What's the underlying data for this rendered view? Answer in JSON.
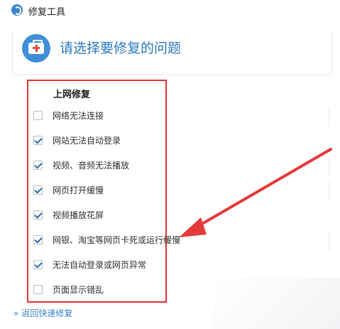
{
  "window": {
    "title": "修复工具"
  },
  "header": {
    "title": "请选择要修复的问题"
  },
  "section": {
    "title": "上网修复",
    "options": [
      {
        "label": "网络无法连接",
        "checked": false
      },
      {
        "label": "网站无法自动登录",
        "checked": true
      },
      {
        "label": "视频、音频无法播放",
        "checked": true
      },
      {
        "label": "网页打开缓慢",
        "checked": true
      },
      {
        "label": "视频播放花屏",
        "checked": true
      },
      {
        "label": "网银、淘宝等网页卡死或运行缓慢",
        "checked": true
      },
      {
        "label": "无法自动登录或网页异常",
        "checked": true
      },
      {
        "label": "页面显示错乱",
        "checked": false
      }
    ]
  },
  "footer": {
    "back_label": "返回快速修复",
    "back_arrows": "»"
  },
  "colors": {
    "accent": "#3a86c8",
    "highlight": "#e53a3a"
  }
}
